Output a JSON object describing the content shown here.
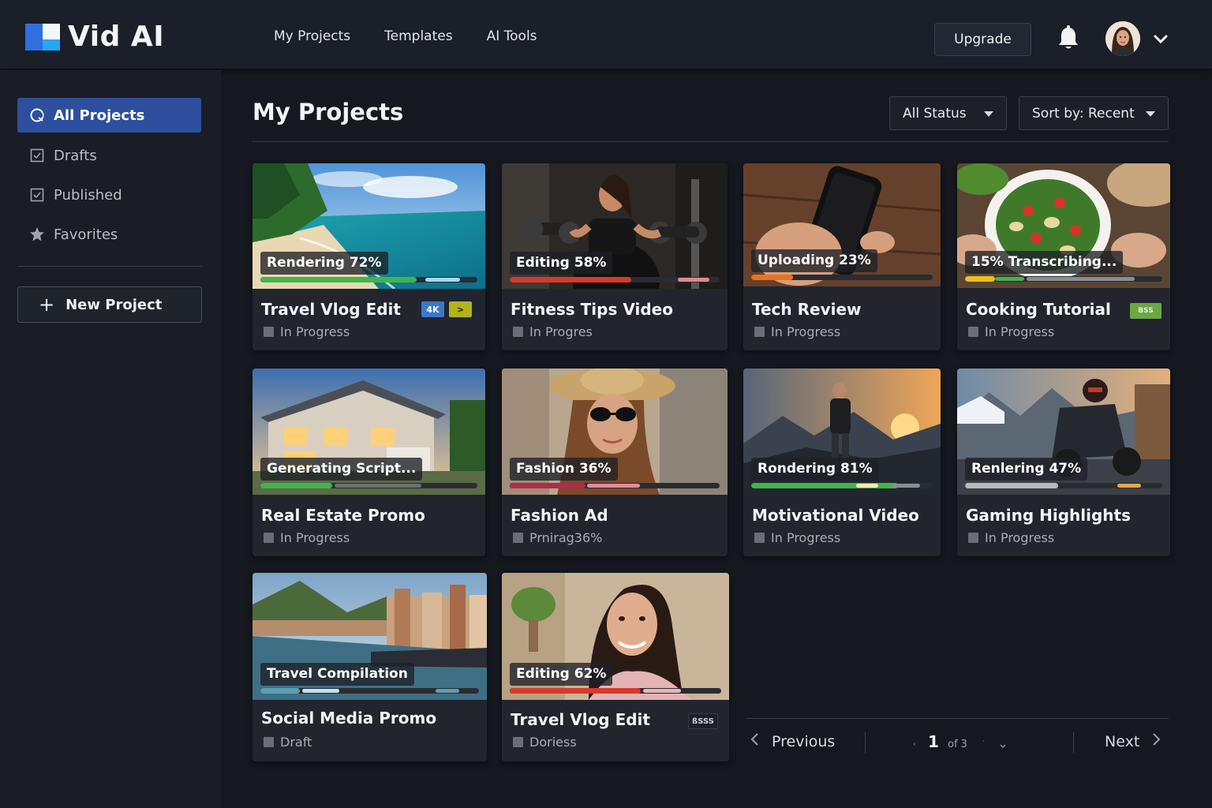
{
  "app": {
    "name": "Vid AI",
    "nav": [
      "My Projects",
      "Templates",
      "AI Tools"
    ],
    "upgrade_label": "Upgrade",
    "icons": {
      "bell": "bell-icon",
      "avatar": "user-avatar",
      "caret": "chevron-down-icon"
    }
  },
  "sidebar": {
    "items": [
      {
        "label": "All Projects",
        "icon": "projects-icon",
        "active": true
      },
      {
        "label": "Drafts",
        "icon": "checkbox-icon",
        "active": false
      },
      {
        "label": "Published",
        "icon": "checkbox-icon",
        "active": false
      },
      {
        "label": "Favorites",
        "icon": "star-icon",
        "active": false
      }
    ],
    "new_project_label": "New Project"
  },
  "main": {
    "title": "My Projects",
    "filter_status": "All Status",
    "sort": "Sort by: Recent"
  },
  "projects": [
    {
      "title": "Travel Vlog Edit",
      "status_chip": "Rendering 72%",
      "progress": 0.72,
      "subtitle": "In Progress",
      "badges": [
        "4K",
        ">"
      ]
    },
    {
      "title": "Fitness Tips Video",
      "status_chip": "Editing 58%",
      "progress": 0.58,
      "subtitle": "In Progres"
    },
    {
      "title": "Tech Review",
      "status_chip": "Uploading 23%",
      "progress": 0.23,
      "subtitle": "In Progress"
    },
    {
      "title": "Cooking Tutorial",
      "status_chip": "15% Transcribing...",
      "progress": 0.15,
      "subtitle": "In Progress",
      "badges": [
        "BSS"
      ]
    },
    {
      "title": "Real Estate Promo",
      "status_chip": "Generating Script...",
      "subtitle": "In Progress"
    },
    {
      "title": "Fashion Ad",
      "status_chip": "Fashion 36%",
      "progress": 0.36,
      "subtitle": "Prnirag36%"
    },
    {
      "title": "Motivational Video",
      "status_chip": "Rondering 81%",
      "progress": 0.81,
      "subtitle": "In Progress"
    },
    {
      "title": "Gaming Highlights",
      "status_chip": "Renlering 47%",
      "progress": 0.47,
      "subtitle": "In Progress"
    },
    {
      "title": "Social Media Promo",
      "status_chip": "Travel Compilation",
      "subtitle": "Draft"
    },
    {
      "title": "Travel Vlog Edit",
      "status_chip": "Editing 62%",
      "progress": 0.62,
      "subtitle": "Doriess",
      "badges": [
        "ßSSS"
      ]
    }
  ],
  "pagination": {
    "previous_label": "Previous",
    "next_label": "Next",
    "current_page": "1",
    "of_label": "of 3"
  },
  "colors": {
    "accent": "#2e4f9e",
    "background": "#15181f",
    "card": "#22252d",
    "progress_green": "#3fb54a",
    "progress_orange": "#e9721f",
    "progress_red": "#d63a2a"
  }
}
